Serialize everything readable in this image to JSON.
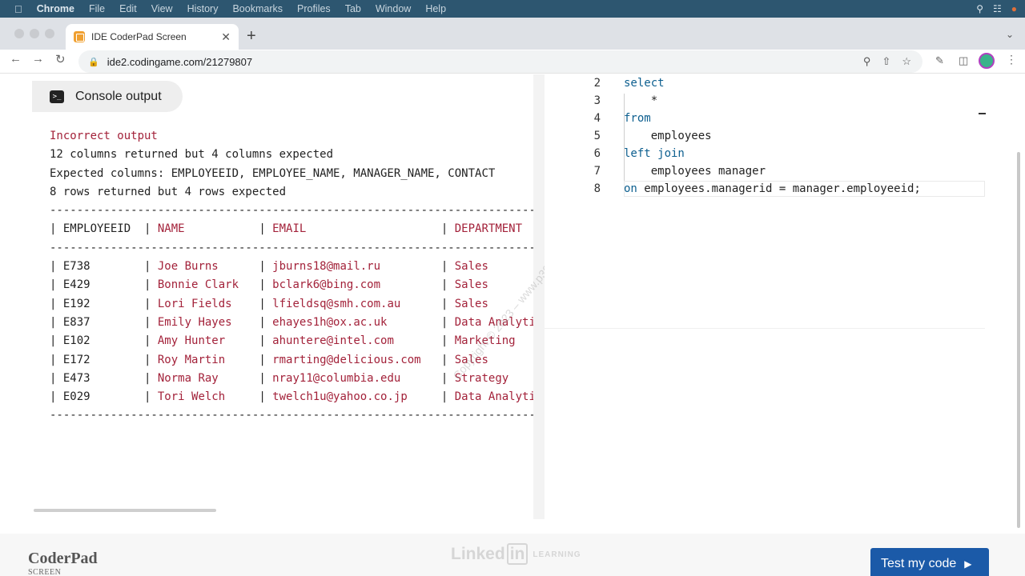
{
  "menubar": {
    "app": "Chrome",
    "items": [
      "File",
      "Edit",
      "View",
      "History",
      "Bookmarks",
      "Profiles",
      "Tab",
      "Window",
      "Help"
    ]
  },
  "browser": {
    "tab_title": "IDE CoderPad Screen",
    "url": "ide2.codingame.com/21279807"
  },
  "console": {
    "tab_label": "Console output",
    "status": "Incorrect output",
    "messages": [
      "12 columns returned but 4 columns expected",
      "Expected columns: EMPLOYEEID, EMPLOYEE_NAME, MANAGER_NAME, CONTACT",
      "8 rows returned but 4 rows expected"
    ],
    "separator": "--------------------------------------------------------------------------",
    "headers": [
      "EMPLOYEEID",
      "NAME",
      "EMAIL",
      "DEPARTMENT"
    ],
    "rows": [
      [
        "E738",
        "Joe Burns",
        "jburns18@mail.ru",
        "Sales"
      ],
      [
        "E429",
        "Bonnie Clark",
        "bclark6@bing.com",
        "Sales"
      ],
      [
        "E192",
        "Lori Fields",
        "lfieldsq@smh.com.au",
        "Sales"
      ],
      [
        "E837",
        "Emily Hayes",
        "ehayes1h@ox.ac.uk",
        "Data Analytics"
      ],
      [
        "E102",
        "Amy Hunter",
        "ahuntere@intel.com",
        "Marketing"
      ],
      [
        "E172",
        "Roy Martin",
        "rmarting@delicious.com",
        "Sales"
      ],
      [
        "E473",
        "Norma Ray",
        "nray11@columbia.edu",
        "Strategy"
      ],
      [
        "E029",
        "Tori Welch",
        "twelch1u@yahoo.co.jp",
        "Data Analytics"
      ]
    ]
  },
  "editor": {
    "lines": [
      {
        "num": "2",
        "text": "select",
        "kw": true
      },
      {
        "num": "3",
        "text": "    *",
        "kw": false
      },
      {
        "num": "4",
        "text": "from",
        "kw": true
      },
      {
        "num": "5",
        "text": "    employees",
        "kw": false
      },
      {
        "num": "6",
        "text": "left join",
        "kw": true
      },
      {
        "num": "7",
        "text": "    employees manager",
        "kw": false
      },
      {
        "num": "8",
        "text": "on employees.managerid = manager.employeeid;",
        "kw": false
      }
    ]
  },
  "footer": {
    "brand": "CoderPad",
    "brand_sub": "SCREEN",
    "linkedin_word": "Linked",
    "linkedin_in": "in",
    "linkedin_learning": "LEARNING",
    "test_button": "Test my code"
  },
  "colors": {
    "error_red": "#a3223a",
    "keyword_blue": "#0d5f8f",
    "button_blue": "#1b5aa8"
  }
}
